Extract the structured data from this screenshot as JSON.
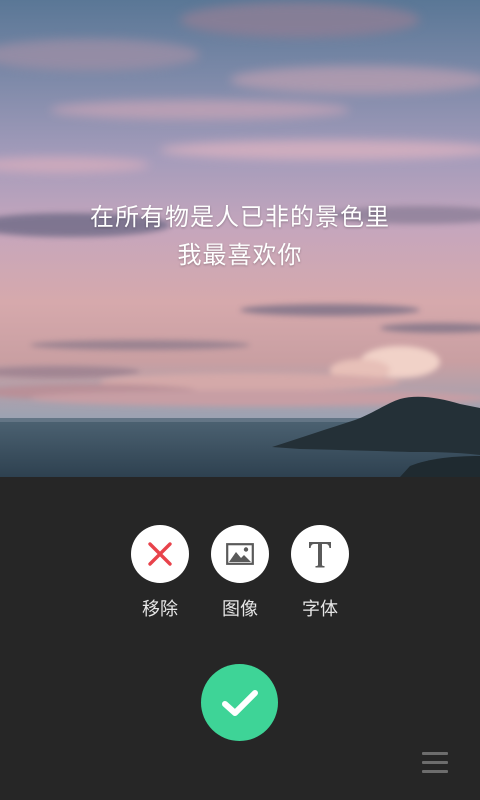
{
  "caption": {
    "line1": "在所有物是人已非的景色里",
    "line2": "我最喜欢你"
  },
  "toolbar": {
    "remove_label": "移除",
    "image_label": "图像",
    "font_label": "字体"
  },
  "icons": {
    "remove": "close-icon",
    "image": "image-icon",
    "font": "text-icon",
    "confirm": "checkmark-icon",
    "menu": "menu-icon"
  },
  "colors": {
    "panel_bg": "#262626",
    "remove_icon": "#e8434b",
    "confirm_bg": "#3ed497",
    "icon_gray": "#5a5a5a"
  }
}
